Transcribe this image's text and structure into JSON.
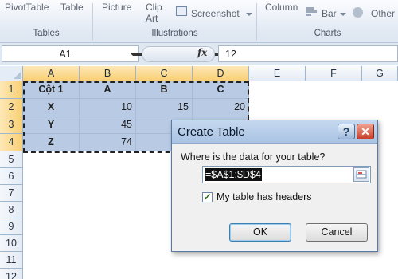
{
  "ribbon": {
    "items": {
      "pivot_table": "PivotTable",
      "table": "Table",
      "picture": "Picture",
      "clip_art_line1": "Clip",
      "clip_art_line2": "Art",
      "screenshot": "Screenshot",
      "column": "Column",
      "bar": "Bar",
      "other": "Other"
    },
    "groups": {
      "tables": "Tables",
      "illustrations": "Illustrations",
      "charts": "Charts"
    }
  },
  "formula_bar": {
    "name_box": "A1",
    "fx": "fx",
    "content": "12"
  },
  "grid": {
    "columns": [
      "A",
      "B",
      "C",
      "D",
      "E",
      "F",
      "G"
    ],
    "rows": [
      "1",
      "2",
      "3",
      "4",
      "5",
      "6",
      "7",
      "8",
      "9",
      "10",
      "11",
      "12"
    ],
    "cells": {
      "a1": "Cột 1",
      "b1": "A",
      "c1": "B",
      "d1": "C",
      "a2": "X",
      "b2": "10",
      "c2": "15",
      "d2": "20",
      "a3": "Y",
      "b3": "45",
      "a4": "Z",
      "b4": "74"
    }
  },
  "dialog": {
    "title": "Create Table",
    "help": "?",
    "close": "✕",
    "question": "Where is the data for your table?",
    "range": "=$A$1:$D$4",
    "has_headers_label": "My table has headers",
    "has_headers_checked": "✓",
    "ok": "OK",
    "cancel": "Cancel"
  },
  "colors": {
    "selection": "#b9cbe4",
    "header_highlight": "#f9cf74",
    "dialog_title": "#a9c3e3"
  }
}
